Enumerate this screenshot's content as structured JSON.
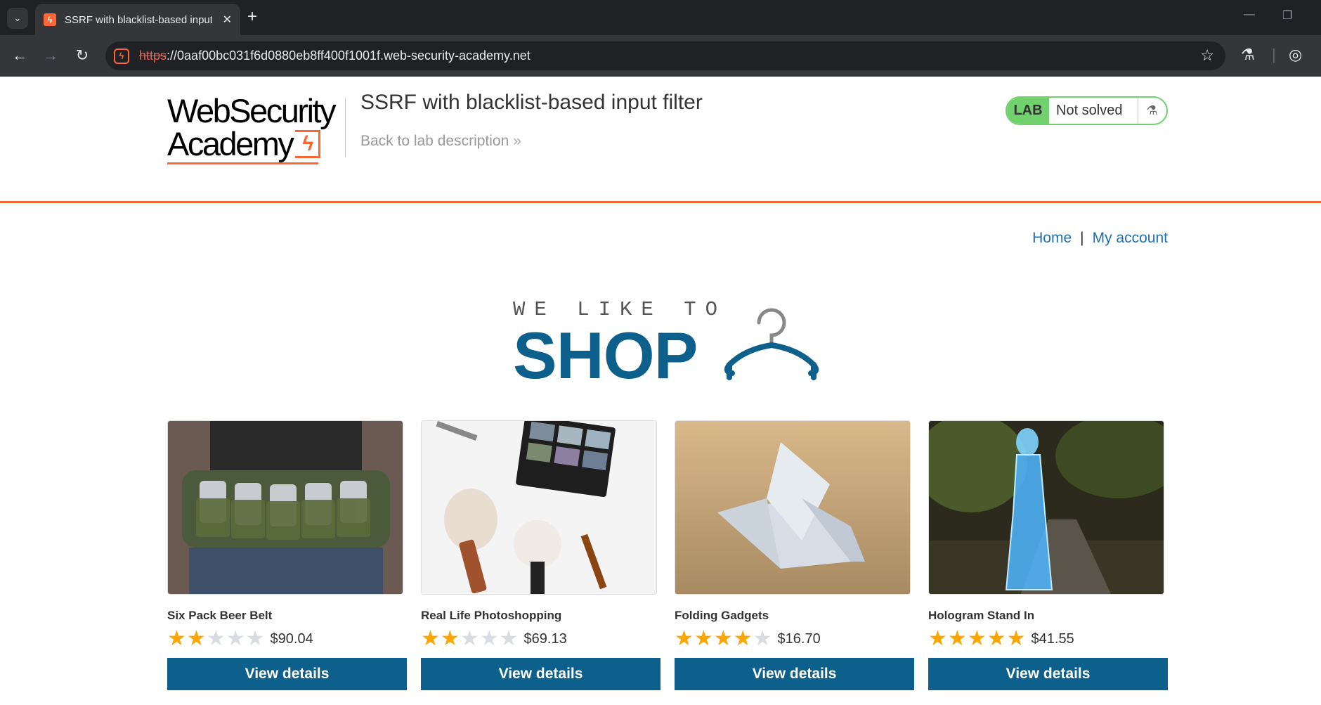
{
  "browser": {
    "tab_title": "SSRF with blacklist-based input filter",
    "tab_close": "✕",
    "newtab": "+",
    "url_scheme": "https",
    "url_rest": "://0aaf00bc031f6d0880eb8ff400f1001f.web-security-academy.net"
  },
  "header": {
    "logo_line1": "WebSecurity",
    "logo_line2": "Academy",
    "lab_title": "SSRF with blacklist-based input filter",
    "back_link": "Back to lab description",
    "lab_badge": "LAB",
    "lab_status": "Not solved"
  },
  "nav": {
    "home": "Home",
    "separator": "|",
    "account": "My account"
  },
  "banner": {
    "small": "WE LIKE TO",
    "big": "SHOP"
  },
  "products": [
    {
      "name": "Six Pack Beer Belt",
      "rating": 2,
      "price": "$90.04",
      "button": "View details"
    },
    {
      "name": "Real Life Photoshopping",
      "rating": 2,
      "price": "$69.13",
      "button": "View details"
    },
    {
      "name": "Folding Gadgets",
      "rating": 4,
      "price": "$16.70",
      "button": "View details"
    },
    {
      "name": "Hologram Stand In",
      "rating": 5,
      "price": "$41.55",
      "button": "View details"
    }
  ],
  "colors": {
    "accent": "#ff6633",
    "primary": "#0d5f8c",
    "link": "#1f6fb5",
    "lab_green": "#70d16d",
    "star_on": "#ffa500",
    "star_off": "#d8dde3"
  }
}
